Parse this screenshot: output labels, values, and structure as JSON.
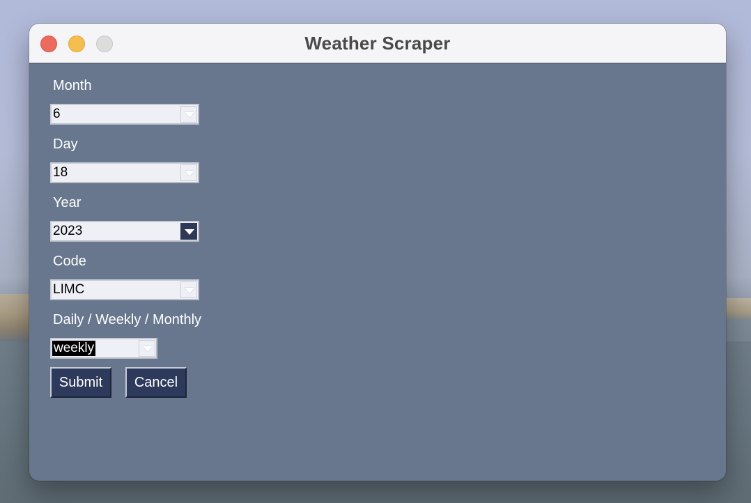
{
  "window": {
    "title": "Weather Scraper"
  },
  "form": {
    "month": {
      "label": "Month",
      "value": "6"
    },
    "day": {
      "label": "Day",
      "value": "18"
    },
    "year": {
      "label": "Year",
      "value": "2023"
    },
    "code": {
      "label": "Code",
      "value": "LIMC"
    },
    "period": {
      "label": "Daily / Weekly / Monthly",
      "value": "weekly"
    }
  },
  "buttons": {
    "submit": "Submit",
    "cancel": "Cancel"
  },
  "colors": {
    "window_bg": "#68778d",
    "button_bg": "#2d3a5b",
    "accent_arrow": "#2d3956",
    "traffic_close": "#ed6a5e",
    "traffic_minimize": "#f5bf4f",
    "traffic_zoom": "#dcdcdc"
  }
}
